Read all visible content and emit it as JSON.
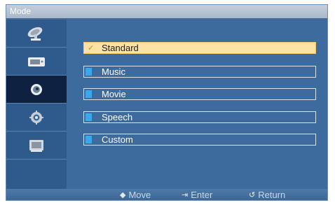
{
  "title": "Mode",
  "sidebar": {
    "items": [
      {
        "icon": "satellite-dish-icon",
        "active": false
      },
      {
        "icon": "picture-icon",
        "active": false
      },
      {
        "icon": "sound-icon",
        "active": true
      },
      {
        "icon": "setup-gear-icon",
        "active": false
      },
      {
        "icon": "input-source-icon",
        "active": false
      }
    ]
  },
  "menu": {
    "items": [
      {
        "label": "Standard",
        "selected": true
      },
      {
        "label": "Music",
        "selected": false
      },
      {
        "label": "Movie",
        "selected": false
      },
      {
        "label": "Speech",
        "selected": false
      },
      {
        "label": "Custom",
        "selected": false
      }
    ]
  },
  "footer": {
    "move_label": "Move",
    "enter_label": "Enter",
    "return_label": "Return"
  },
  "colors": {
    "panel": "#3e6b9d",
    "highlight": "#fde2a6",
    "marker": "#3aa8ea"
  }
}
